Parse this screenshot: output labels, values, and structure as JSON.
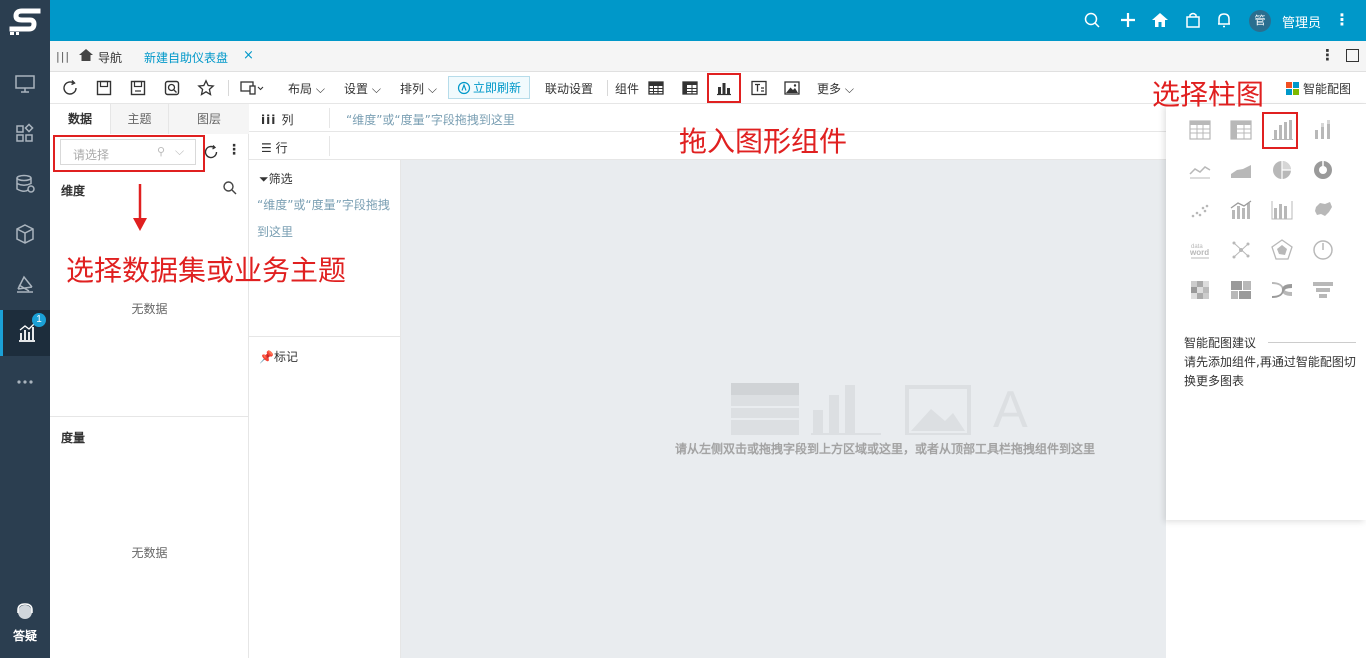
{
  "topbar": {
    "avatar_text": "管",
    "username": "管理员"
  },
  "tabbar": {
    "nav_label": "导航",
    "active_tab": "新建自助仪表盘",
    "close": "×"
  },
  "toolbar": {
    "layout_label": "布局",
    "settings_label": "设置",
    "arrange_label": "排列",
    "refresh_label": "立即刷新",
    "linkage_label": "联动设置",
    "components_label": "组件",
    "more_label": "更多",
    "smart_chart_label": "智能配图"
  },
  "datapanel": {
    "tabs": [
      "数据",
      "主题",
      "图层"
    ],
    "select_placeholder": "请选择",
    "dimension_title": "维度",
    "dimension_empty": "无数据",
    "measure_title": "度量",
    "measure_empty": "无数据"
  },
  "shelves": {
    "column_label": "列",
    "row_label": "行",
    "column_hint": "“维度”或“度量”字段拖拽到这里"
  },
  "filter": {
    "title": "筛选",
    "hint": "“维度”或“度量”字段拖拽到这里",
    "mark_title": "标记"
  },
  "canvas": {
    "hint": "请从左侧双击或拖拽字段到上方区域或这里，或者从顶部工具栏拖拽组件到这里"
  },
  "comp_panel": {
    "suggest_title": "智能配图建议",
    "suggest_text": "请先添加组件,再通过智能配图切换更多图表"
  },
  "annotations": {
    "select_dataset": "选择数据集或业务主题",
    "drag_component": "拖入图形组件",
    "select_bar": "选择柱图"
  },
  "leftnav": {
    "badge": "1",
    "help_label": "答疑"
  },
  "colors": {
    "topbar": "#0098c9",
    "nav": "#2b3e50",
    "annotation": "#e02020",
    "accent": "#0098c9"
  }
}
